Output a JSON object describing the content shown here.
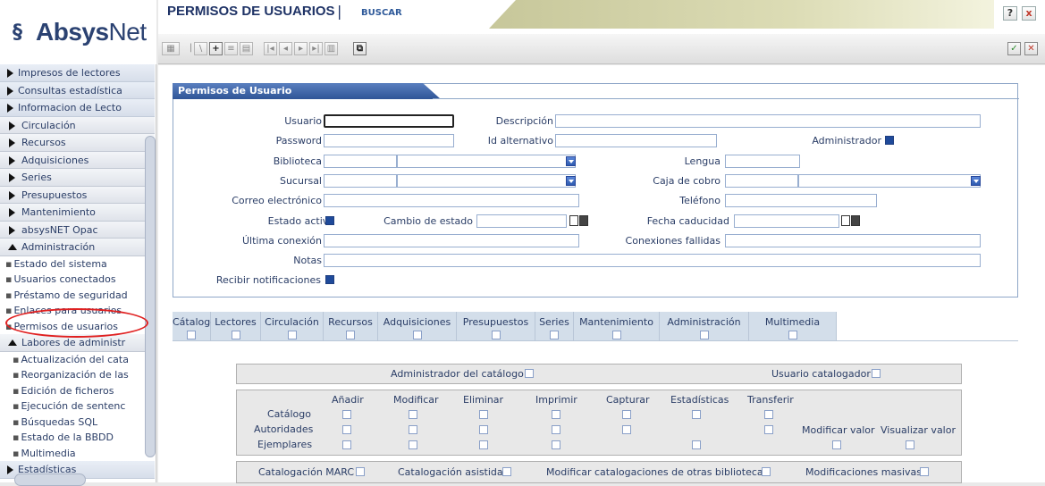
{
  "app": {
    "logo_symbol": "§",
    "logo_bold": "Absys",
    "logo_light": "Net"
  },
  "sidebar": {
    "top_items": [
      "Impresos de lectores",
      "Consultas estadística",
      "Informacion de Lecto"
    ],
    "sections": [
      "Circulación",
      "Recursos",
      "Adquisiciones",
      "Series",
      "Presupuestos",
      "Mantenimiento",
      "absysNET Opac"
    ],
    "open_section": "Administración",
    "admin_items": [
      "Estado del sistema",
      "Usuarios conectados",
      "Préstamo de seguridad",
      "Enlaces para usuarios",
      "Permisos de usuarios"
    ],
    "sub_open": "Labores de administr",
    "sub_items": [
      "Actualización del cata",
      "Reorganización de las",
      "Edición de ficheros",
      "Ejecución de sentenc",
      "Búsquedas SQL",
      "Estado de la BBDD",
      "Multimedia"
    ],
    "last_section": "Estadísticas"
  },
  "header": {
    "title": "PERMISOS DE USUARIOS",
    "separator": "|",
    "search_link": "BUSCAR",
    "help": "?",
    "close": "x"
  },
  "panel": {
    "title": "Permisos de Usuario",
    "labels": {
      "usuario": "Usuario",
      "descripcion": "Descripción",
      "password": "Password",
      "id_alternativo": "Id alternativo",
      "administrador": "Administrador",
      "biblioteca": "Biblioteca",
      "lengua": "Lengua",
      "sucursal": "Sucursal",
      "caja_cobro": "Caja de cobro",
      "correo": "Correo electrónico",
      "telefono": "Teléfono",
      "estado_activo": "Estado activo",
      "cambio_estado": "Cambio de estado",
      "fecha_caducidad": "Fecha caducidad",
      "ultima_conexion": "Última conexión",
      "conexiones_fallidas": "Conexiones fallidas",
      "notas": "Notas",
      "recibir_notificaciones": "Recibir notificaciones"
    },
    "values": {
      "usuario": "",
      "descripcion": "",
      "password": "",
      "id_alternativo": "",
      "correo": "",
      "telefono": "",
      "notas": ""
    }
  },
  "tabs": [
    "Cátalogo",
    "Lectores",
    "Circulación",
    "Recursos",
    "Adquisiciones",
    "Presupuestos",
    "Series",
    "Mantenimiento",
    "Administración",
    "Multimedia"
  ],
  "catalog": {
    "admin_catalogo": "Administrador del catálogo",
    "usuario_catalogador": "Usuario catalogador",
    "columns": [
      "Añadir",
      "Modificar",
      "Eliminar",
      "Imprimir",
      "Capturar",
      "Estadísticas",
      "Transferir"
    ],
    "rows": [
      "Catálogo",
      "Autoridades",
      "Ejemplares"
    ],
    "modificar_valor": "Modificar valor",
    "visualizar_valor": "Visualizar valor",
    "bottom": [
      "Catalogación MARC",
      "Catalogación asistida",
      "Modificar catalogaciones de otras bibliotecas",
      "Modificaciones masivas"
    ]
  }
}
